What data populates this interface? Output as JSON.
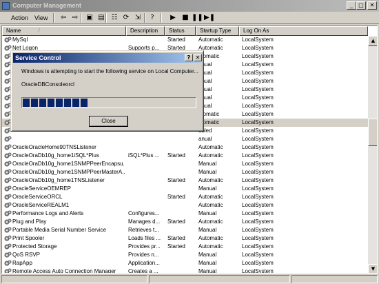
{
  "window": {
    "title": "Computer Management",
    "caption_buttons": [
      "_",
      "□",
      "✕"
    ]
  },
  "menu": {
    "items": [
      "Action",
      "View"
    ]
  },
  "toolbar": {
    "icons": [
      "back-icon",
      "forward-icon",
      "up-folder-icon",
      "show-hide-tree-icon",
      "properties-icon",
      "refresh-icon",
      "export-list-icon",
      "help-icon",
      "start-service-icon",
      "stop-service-icon",
      "pause-service-icon",
      "restart-service-icon"
    ],
    "glyphs": [
      "⇦",
      "⇨",
      "▣",
      "▤",
      "☷",
      "⟳",
      "⇲",
      "?",
      "▶",
      "■",
      "❚❚",
      "▶❚"
    ]
  },
  "list": {
    "columns": [
      "Name",
      "Description",
      "Status",
      "Startup Type",
      "Log On As"
    ],
    "sort_indicator": "/",
    "rows": [
      {
        "name": "MySql",
        "desc": "",
        "status": "Started",
        "startup": "Automatic",
        "logon": "LocalSystem"
      },
      {
        "name": "Net Logon",
        "desc": "Supports p...",
        "status": "Started",
        "startup": "Automatic",
        "logon": "LocalSystem"
      },
      {
        "name": "",
        "desc": "",
        "status": "",
        "startup": "utomatic",
        "logon": "LocalSystem"
      },
      {
        "name": "",
        "desc": "",
        "status": "",
        "startup": "anual",
        "logon": "LocalSystem"
      },
      {
        "name": "",
        "desc": "",
        "status": "",
        "startup": "anual",
        "logon": "LocalSystem"
      },
      {
        "name": "",
        "desc": "",
        "status": "",
        "startup": "anual",
        "logon": "LocalSystem"
      },
      {
        "name": "",
        "desc": "",
        "status": "",
        "startup": "anual",
        "logon": "LocalSystem"
      },
      {
        "name": "",
        "desc": "",
        "status": "",
        "startup": "anual",
        "logon": "LocalSystem"
      },
      {
        "name": "",
        "desc": "",
        "status": "",
        "startup": "anual",
        "logon": "LocalSystem"
      },
      {
        "name": "",
        "desc": "",
        "status": "",
        "startup": "utomatic",
        "logon": "LocalSystem"
      },
      {
        "name": "",
        "desc": "",
        "status": "",
        "startup": "utomatic",
        "logon": "LocalSystem",
        "selected": true
      },
      {
        "name": "",
        "desc": "",
        "status": "",
        "startup": "abled",
        "logon": "LocalSystem"
      },
      {
        "name": "",
        "desc": "",
        "status": "",
        "startup": "anual",
        "logon": "LocalSystem"
      },
      {
        "name": "OracleOracleHome90TNSListener",
        "desc": "",
        "status": "",
        "startup": "Automatic",
        "logon": "LocalSystem"
      },
      {
        "name": "OracleOraDb10g_home1iSQL*Plus",
        "desc": "iSQL*Plus ...",
        "status": "Started",
        "startup": "Automatic",
        "logon": "LocalSystem"
      },
      {
        "name": "OracleOraDb10g_home1SNMPPeerEncapsu...",
        "desc": "",
        "status": "",
        "startup": "Manual",
        "logon": "LocalSystem"
      },
      {
        "name": "OracleOraDb10g_home1SNMPPeerMasterA...",
        "desc": "",
        "status": "",
        "startup": "Manual",
        "logon": "LocalSystem"
      },
      {
        "name": "OracleOraDb10g_home1TNSListener",
        "desc": "",
        "status": "Started",
        "startup": "Automatic",
        "logon": "LocalSystem"
      },
      {
        "name": "OracleServiceOEMREP",
        "desc": "",
        "status": "",
        "startup": "Manual",
        "logon": "LocalSystem"
      },
      {
        "name": "OracleServiceORCL",
        "desc": "",
        "status": "Started",
        "startup": "Automatic",
        "logon": "LocalSystem"
      },
      {
        "name": "OracleServiceREALM1",
        "desc": "",
        "status": "",
        "startup": "Automatic",
        "logon": "LocalSystem"
      },
      {
        "name": "Performance Logs and Alerts",
        "desc": "Configures...",
        "status": "",
        "startup": "Manual",
        "logon": "LocalSystem"
      },
      {
        "name": "Plug and Play",
        "desc": "Manages d...",
        "status": "Started",
        "startup": "Automatic",
        "logon": "LocalSystem"
      },
      {
        "name": "Portable Media Serial Number Service",
        "desc": "Retrieves t...",
        "status": "",
        "startup": "Manual",
        "logon": "LocalSystem"
      },
      {
        "name": "Print Spooler",
        "desc": "Loads files ...",
        "status": "Started",
        "startup": "Automatic",
        "logon": "LocalSystem"
      },
      {
        "name": "Protected Storage",
        "desc": "Provides pr...",
        "status": "Started",
        "startup": "Automatic",
        "logon": "LocalSystem"
      },
      {
        "name": "QoS RSVP",
        "desc": "Provides n...",
        "status": "",
        "startup": "Manual",
        "logon": "LocalSystem"
      },
      {
        "name": "RapApp",
        "desc": "Application...",
        "status": "",
        "startup": "Manual",
        "logon": "LocalSystem"
      },
      {
        "name": "Remote Access Auto Connection Manager",
        "desc": "Creates a ...",
        "status": "",
        "startup": "Manual",
        "logon": "LocalSystem"
      },
      {
        "name": "Remote Access Connection Manager",
        "desc": "Creates a ...",
        "status": "Started",
        "startup": "Manual",
        "logon": "LocalSystem"
      }
    ]
  },
  "scrollbar": {
    "up_arrow": "▲",
    "down_arrow": "▼"
  },
  "dialog": {
    "title": "Service Control",
    "help_button": "?",
    "close_x": "✕",
    "message": "Windows is attempting to start the following service on Local Computer...",
    "service_name": "OracleDBConsoleorcl",
    "progress": 0.36,
    "close_label": "Close"
  },
  "colors": {
    "dialog_title_start": "#0a246a",
    "dialog_title_end": "#a6caf0",
    "progress_fill": "#0a246a",
    "window_title_inactive": "#7f7f7f"
  }
}
